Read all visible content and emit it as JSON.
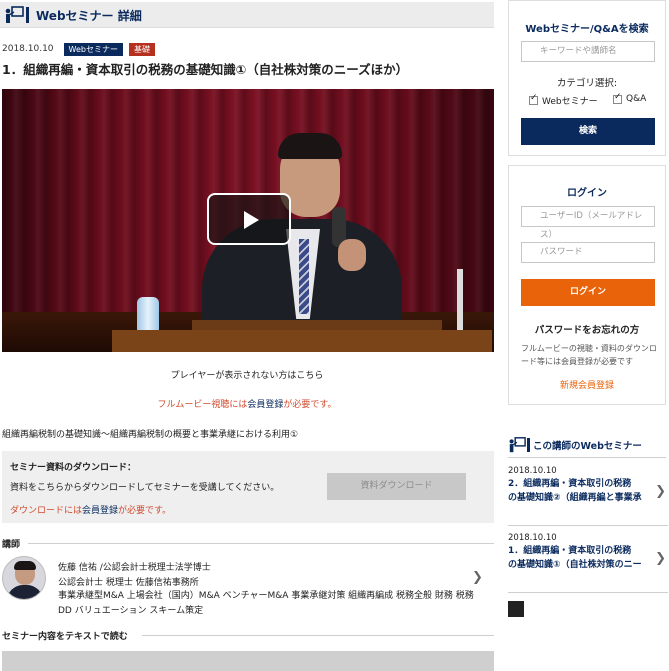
{
  "header": {
    "title": "Webセミナー 詳細",
    "icon": "presenter-board-icon"
  },
  "seminar": {
    "date": "2018.10.10",
    "tags": [
      "Webセミナー",
      "基礎"
    ],
    "title": "1．組織再編・資本取引の税務の基礎知識①（自社株対策のニーズほか）",
    "player_note": "プレイヤーが表示されない方はこちら",
    "fullmovie_pre": "フルムービー視聴には",
    "fullmovie_link": "会員登録",
    "fullmovie_post": "が必要です。",
    "description": "組織再編税制の基礎知識～組織再編税制の概要と事業承継における利用①"
  },
  "download": {
    "heading": "セミナー資料のダウンロード：",
    "text": "資料をこちらからダウンロードしてセミナーを受講してください。",
    "note_pre": "ダウンロードには",
    "note_link": "会員登録",
    "note_post": "が必要です。",
    "button": "資料ダウンロード"
  },
  "instructor": {
    "section": "講師",
    "name": "佐藤 信祐 /公認会計士税理士法学博士",
    "office": "公認会計士 税理士 佐藤信祐事務所",
    "bio": "事業承継型M&A 上場会社（国内）M&A ベンチャーM&A 事業承継対策 組織再編成 税務全般 財務 税務DD バリュエーション スキーム策定"
  },
  "text_section": "セミナー内容をテキストで読む",
  "sidebar": {
    "search": {
      "title": "Webセミナー/Q&Aを検索",
      "placeholder": "キーワードや講師名",
      "category_label": "カテゴリ選択:",
      "categories": [
        "Webセミナー",
        "Q&A"
      ],
      "button": "検索"
    },
    "login": {
      "title": "ログイン",
      "user_placeholder": "ユーザーID（メールアドレス）",
      "password_placeholder": "パスワード",
      "button": "ログイン",
      "forgot": "パスワードをお忘れの方",
      "note": "フルムービーの視聴・資料のダウンロード等には会員登録が必要です",
      "register": "新規会員登録"
    },
    "related": {
      "heading": "この講師のWebセミナー",
      "items": [
        {
          "date": "2018.10.10",
          "title": "2．組織再編・資本取引の税務",
          "subtitle": "の基礎知識②（組織再編と事業承"
        },
        {
          "date": "2018.10.10",
          "title": "1．組織再編・資本取引の税務",
          "subtitle": "の基礎知識①（自社株対策のニー"
        }
      ]
    }
  },
  "colors": {
    "navy": "#0a2a5e",
    "orange": "#e8630a",
    "red": "#b5301f"
  }
}
